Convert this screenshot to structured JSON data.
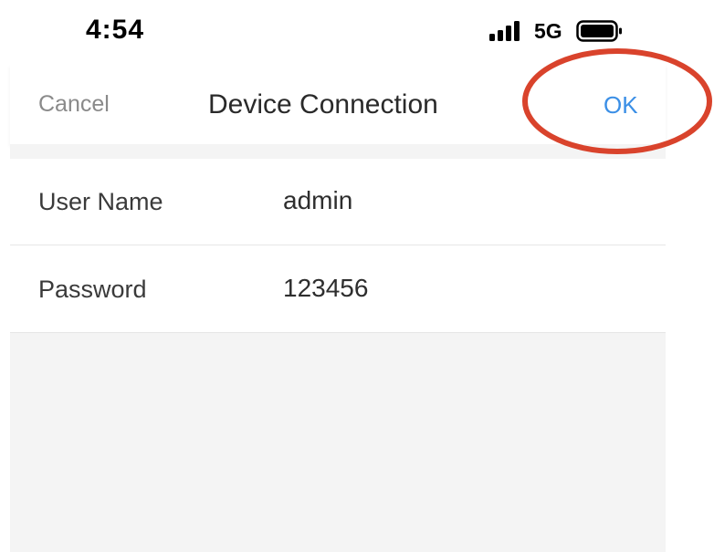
{
  "status_bar": {
    "time": "4:54",
    "network": "5G",
    "signal_icon": "signal-bars-icon",
    "battery_icon": "battery-full-icon"
  },
  "nav": {
    "cancel_label": "Cancel",
    "title": "Device Connection",
    "ok_label": "OK"
  },
  "form": {
    "rows": [
      {
        "label": "User Name",
        "value": "admin"
      },
      {
        "label": "Password",
        "value": "123456"
      }
    ]
  },
  "colors": {
    "ok_blue": "#3b8fe6",
    "annotation_red": "#d9432c",
    "background_gray": "#f4f4f4"
  }
}
